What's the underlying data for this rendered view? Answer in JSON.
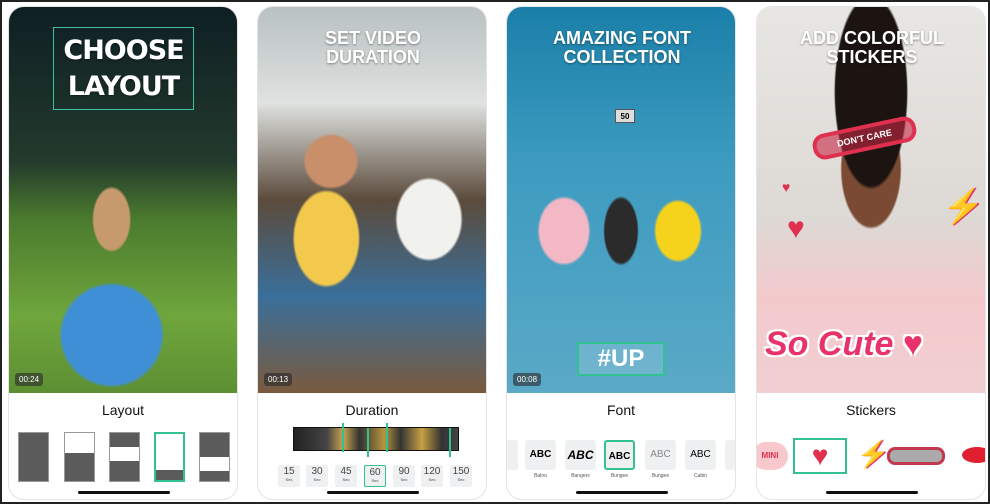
{
  "accent": "#34c190",
  "panels": [
    {
      "headline": "CHOOSE LAYOUT",
      "timestamp": "00:24",
      "label": "Layout"
    },
    {
      "headline": "SET VIDEO DURATION",
      "timestamp": "00:13",
      "label": "Duration",
      "durations": [
        {
          "value": "15",
          "unit": "Sec"
        },
        {
          "value": "30",
          "unit": "Sec"
        },
        {
          "value": "45",
          "unit": "Sec"
        },
        {
          "value": "60",
          "unit": "Sec"
        },
        {
          "value": "90",
          "unit": "Sec"
        },
        {
          "value": "120",
          "unit": "Sec"
        },
        {
          "value": "150",
          "unit": "Sec"
        }
      ],
      "selected_duration": "60"
    },
    {
      "headline": "AMAZING FONT COLLECTION",
      "timestamp": "00:08",
      "label": "Font",
      "overlay_text": "#UP",
      "chair_number": "50",
      "fonts": [
        {
          "sample": "C",
          "name": "ant"
        },
        {
          "sample": "ABC",
          "name": "Baloo"
        },
        {
          "sample": "ABC",
          "name": "Bangers"
        },
        {
          "sample": "ABC",
          "name": "Bungee"
        },
        {
          "sample": "ABC",
          "name": "Bungee"
        },
        {
          "sample": "ABC",
          "name": "Cabin"
        },
        {
          "sample": "A",
          "name": "C"
        }
      ],
      "selected_font": "Bungee"
    },
    {
      "headline": "ADD COLORFUL STICKERS",
      "label": "Stickers",
      "sticker_text": "So Cute",
      "glasses_text": "DON'T CARE",
      "mini_text": "MINI"
    }
  ]
}
